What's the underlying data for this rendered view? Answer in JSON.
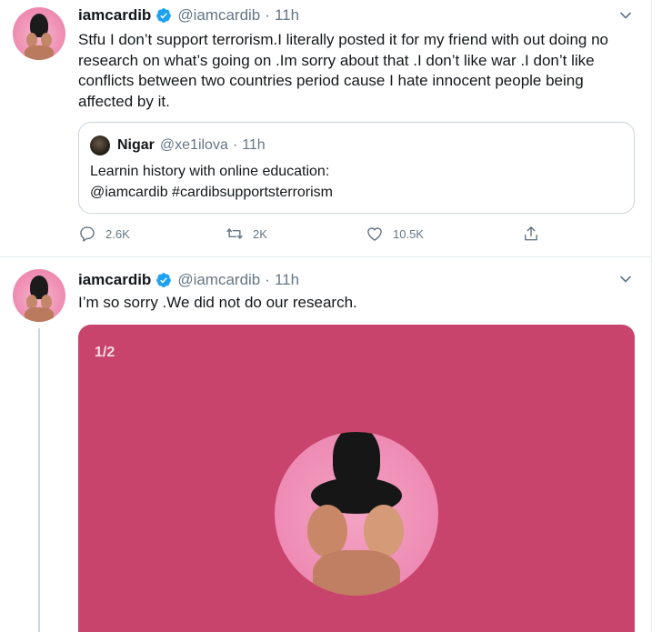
{
  "colors": {
    "accent": "#1da1f2",
    "media_bg": "#c9446c",
    "muted": "#657786"
  },
  "tweets": [
    {
      "name": "iamcardib",
      "handle": "@iamcardib",
      "separator": "·",
      "time": "11h",
      "verified_icon": "verified-badge-icon",
      "text": "Stfu I don’t support terrorism.I literally posted it for my friend with out doing no research on what’s going on .Im sorry about that .I don’t like war .I don’t like conflicts between two countries period cause I hate innocent people being affected by it.",
      "quote": {
        "name": "Nigar",
        "handle": "@xe1ilova",
        "separator": "·",
        "time": "11h",
        "text_line1": "Learnin history with online education:",
        "text_line2": "@iamcardib #cardibsupportsterrorism"
      },
      "actions": {
        "replies": "2.6K",
        "retweets": "2K",
        "likes": "10.5K"
      }
    },
    {
      "name": "iamcardib",
      "handle": "@iamcardib",
      "separator": "·",
      "time": "11h",
      "verified_icon": "verified-badge-icon",
      "text": "I’m so sorry .We did not do our research.",
      "media": {
        "counter": "1/2"
      }
    }
  ]
}
